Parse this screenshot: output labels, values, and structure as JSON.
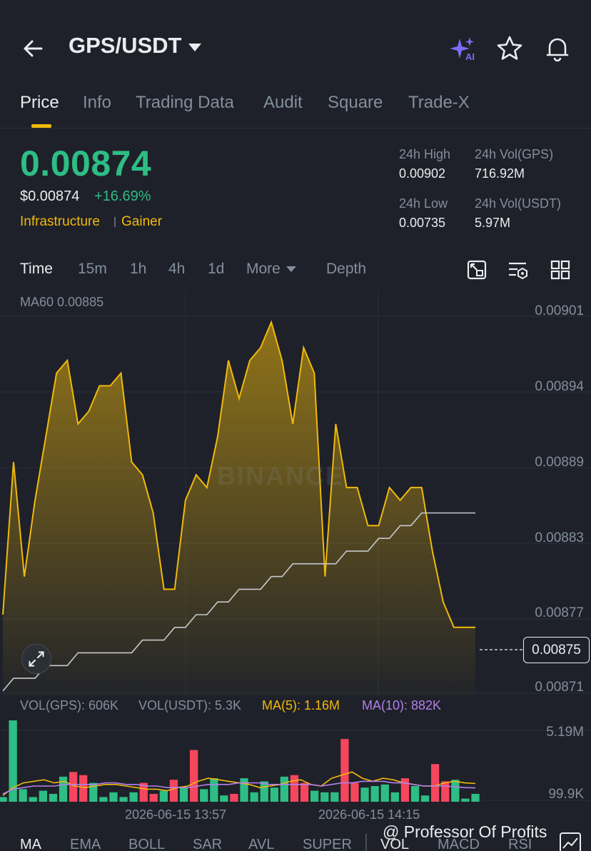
{
  "header": {
    "pair": "GPS/USDT",
    "icons": [
      "back-arrow-icon",
      "ai-sparkle-icon",
      "star-icon",
      "bell-icon"
    ],
    "ai_badge": "AI"
  },
  "tabs": [
    {
      "label": "Price",
      "active": true
    },
    {
      "label": "Info"
    },
    {
      "label": "Trading Data"
    },
    {
      "label": "Audit"
    },
    {
      "label": "Square"
    },
    {
      "label": "Trade-X"
    }
  ],
  "ticker": {
    "last_price": "0.00874",
    "usd_price": "$0.00874",
    "change": "+16.69%",
    "tag1": "Infrastructure",
    "tag2": "Gainer",
    "high_label": "24h High",
    "high": "0.00902",
    "low_label": "24h Low",
    "low": "0.00735",
    "vol_base_label": "24h Vol(GPS)",
    "vol_base": "716.92M",
    "vol_quote_label": "24h Vol(USDT)",
    "vol_quote": "5.97M"
  },
  "timeframes": {
    "items": [
      "Time",
      "15m",
      "1h",
      "4h",
      "1d"
    ],
    "more": "More",
    "depth": "Depth",
    "tool_icons": [
      "chart-settings-icon",
      "indicator-settings-icon",
      "grid-layout-icon"
    ]
  },
  "overlay": {
    "ma60_label": "MA60 0.00885",
    "current_price_tag": "0.00875",
    "watermark": "BINANCE"
  },
  "volume": {
    "vol_gps": "VOL(GPS): 606K",
    "vol_usdt": "VOL(USDT): 5.3K",
    "ma5": "MA(5): 1.16M",
    "ma10": "MA(10): 882K",
    "max_label": "5.19M",
    "min_label": "99.9K"
  },
  "x_labels": [
    "2026-06-15 13:57",
    "2026-06-15 14:15"
  ],
  "indicators": [
    "MA",
    "EMA",
    "BOLL",
    "SAR",
    "AVL",
    "SUPER",
    "VOL",
    "MACD",
    "RSI"
  ],
  "credit": "@ Professor Of Profits",
  "colors": {
    "bg": "#1e2129",
    "up": "#2ebd85",
    "down": "#f6465d",
    "accent": "#f0b90b",
    "ma10": "#b37feb",
    "ma60": "#c6c9ce",
    "muted": "#848e9c"
  },
  "chart_data": {
    "type": "area",
    "price_axis_ticks": [
      "0.00901",
      "0.00894",
      "0.00889",
      "0.00883",
      "0.00877",
      "0.00871"
    ],
    "ylim": [
      0.008696,
      0.009016
    ],
    "price": [
      0.00876,
      0.00888,
      0.00879,
      0.00885,
      0.0089,
      0.00895,
      0.00896,
      0.00891,
      0.00892,
      0.00894,
      0.00894,
      0.00895,
      0.00888,
      0.00887,
      0.00884,
      0.00878,
      0.00878,
      0.00885,
      0.00887,
      0.00886,
      0.0089,
      0.00896,
      0.00893,
      0.00896,
      0.00897,
      0.00899,
      0.00896,
      0.00891,
      0.00897,
      0.00895,
      0.00879,
      0.00891,
      0.00886,
      0.00886,
      0.00883,
      0.00883,
      0.00886,
      0.00885,
      0.00886,
      0.00886,
      0.00881,
      0.00877,
      0.00875,
      0.00875,
      0.00875
    ],
    "ma60": [
      0.0087,
      0.00871,
      0.00871,
      0.00871,
      0.00872,
      0.00872,
      0.00872,
      0.00873,
      0.00873,
      0.00873,
      0.00873,
      0.00873,
      0.00873,
      0.00874,
      0.00874,
      0.00874,
      0.00875,
      0.00875,
      0.00876,
      0.00876,
      0.00877,
      0.00877,
      0.00878,
      0.00878,
      0.00878,
      0.00879,
      0.00879,
      0.0088,
      0.0088,
      0.0088,
      0.0088,
      0.0088,
      0.00881,
      0.00881,
      0.00881,
      0.00882,
      0.00882,
      0.00883,
      0.00883,
      0.00884,
      0.00884,
      0.00884,
      0.00884,
      0.00884,
      0.00884
    ],
    "volume": [
      0.3,
      5.19,
      0.8,
      0.3,
      0.7,
      0.5,
      1.6,
      1.9,
      1.7,
      1.2,
      0.3,
      0.6,
      0.3,
      0.6,
      1.2,
      0.5,
      0.7,
      1.4,
      0.9,
      3.3,
      0.8,
      1.5,
      0.4,
      0.5,
      1.5,
      0.6,
      1.3,
      0.9,
      1.6,
      1.7,
      1.2,
      0.7,
      0.6,
      0.6,
      4.0,
      1.2,
      0.9,
      1.0,
      1.1,
      0.6,
      1.5,
      1.0,
      0.4,
      2.4,
      1.3,
      1.4,
      0.2,
      0.5
    ],
    "volume_dir": [
      "up",
      "up",
      "up",
      "up",
      "up",
      "up",
      "up",
      "down",
      "down",
      "up",
      "up",
      "up",
      "up",
      "up",
      "down",
      "down",
      "up",
      "down",
      "up",
      "down",
      "up",
      "up",
      "up",
      "down",
      "up",
      "up",
      "up",
      "up",
      "up",
      "down",
      "down",
      "up",
      "up",
      "up",
      "down",
      "down",
      "up",
      "up",
      "up",
      "up",
      "down",
      "up",
      "up",
      "down",
      "down",
      "up",
      "up"
    ],
    "volume_ma5": [
      0.4,
      0.9,
      1.2,
      1.3,
      1.4,
      1.2,
      1.3,
      1.0,
      0.9,
      1.0,
      1.1,
      1.1,
      1.0,
      0.9,
      0.8,
      0.8,
      0.7,
      0.9,
      1.0,
      1.3,
      1.5,
      1.4,
      1.3,
      1.2,
      1.1,
      0.9,
      1.0,
      1.1,
      1.3,
      1.4,
      1.1,
      1.0,
      1.5,
      1.7,
      1.9,
      1.5,
      1.3,
      1.5,
      1.4,
      1.2,
      1.1,
      1.0,
      1.0,
      1.2,
      1.3,
      1.2,
      1.16
    ],
    "volume_ma10": [
      0.5,
      0.8,
      0.9,
      1.0,
      1.0,
      1.0,
      1.1,
      1.1,
      1.1,
      1.1,
      1.2,
      1.2,
      1.1,
      1.1,
      1.0,
      1.0,
      0.9,
      0.9,
      0.9,
      1.0,
      1.1,
      1.1,
      1.1,
      1.2,
      1.2,
      1.2,
      1.1,
      1.1,
      1.1,
      1.1,
      1.1,
      1.0,
      1.1,
      1.2,
      1.2,
      1.3,
      1.3,
      1.3,
      1.2,
      1.2,
      1.1,
      1.0,
      1.0,
      1.0,
      0.95,
      0.9,
      0.882
    ]
  }
}
